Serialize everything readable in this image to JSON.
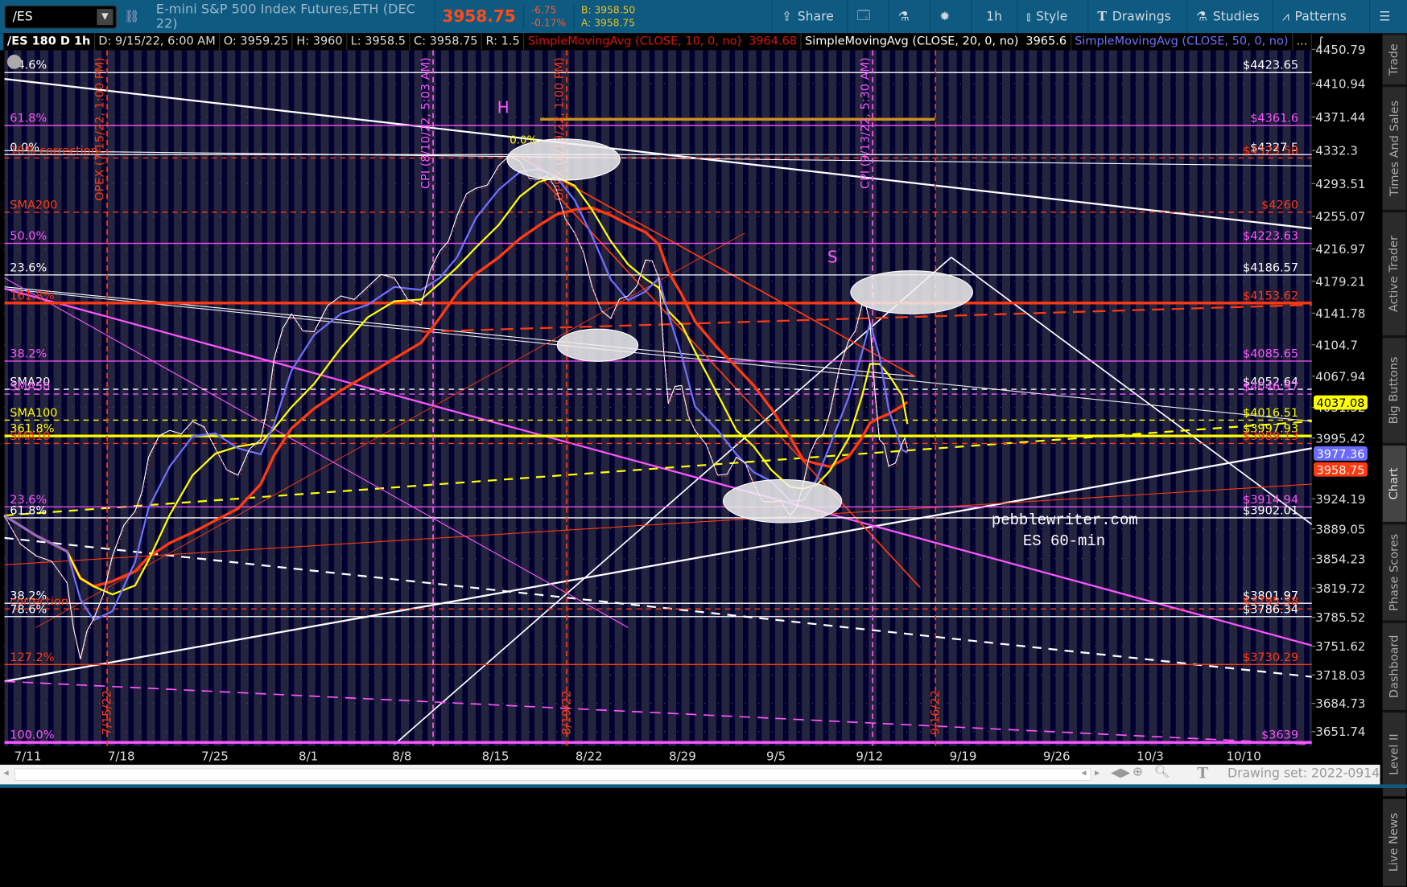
{
  "toolbar": {
    "symbol": "/ES",
    "description": "E-mini S&P 500 Index Futures,ETH (DEC 22)",
    "last": "3958.75",
    "change": "-6.75",
    "change_pct": "-0.17%",
    "bid": "B: 3958.50",
    "ask": "A: 3958.75",
    "buttons": [
      {
        "label": "Share",
        "icon": "share-icon"
      },
      {
        "label": "",
        "icon": "info-card-icon"
      },
      {
        "label": "",
        "icon": "flask-icon"
      },
      {
        "label": "",
        "icon": "gear-icon"
      },
      {
        "label": "1h",
        "icon": ""
      },
      {
        "label": "Style",
        "icon": "candle-icon"
      },
      {
        "label": "Drawings",
        "icon": "text-t-icon"
      },
      {
        "label": "Studies",
        "icon": "flask-icon"
      },
      {
        "label": "Patterns",
        "icon": "patterns-icon"
      },
      {
        "label": "",
        "icon": "menu-icon"
      }
    ]
  },
  "infobar": {
    "title": "/ES 180 D 1h",
    "date": "D: 9/15/22, 6:00 AM",
    "open": "O: 3959.25",
    "high": "H: 3960",
    "low": "L: 3958.5",
    "close": "C: 3958.75",
    "range": "R: 1.5",
    "sma10": "SimpleMovingAvg (CLOSE, 10, 0, no)",
    "sma10_val": "3964.68",
    "sma20": "SimpleMovingAvg (CLOSE, 20, 0, no)",
    "sma20_val": "3965.6",
    "sma50": "SimpleMovingAvg (CLOSE, 50, 0, no)",
    "more": "..."
  },
  "colors": {
    "red": "#ff3a10",
    "magenta": "#ff55ff",
    "white": "#ffffff",
    "yellow": "#ffff00",
    "blue": "#7070ff"
  },
  "price_axis": [
    "4450.79",
    "4410.94",
    "4371.44",
    "4332.3",
    "4293.51",
    "4255.07",
    "4216.97",
    "4179.21",
    "4141.78",
    "4104.7",
    "4067.94",
    "4031.52",
    "3995.42",
    "3924.19",
    "3889.05",
    "3854.23",
    "3819.72",
    "3785.52",
    "3751.62",
    "3718.03",
    "3684.73",
    "3651.74"
  ],
  "date_axis": [
    {
      "label": "7/11",
      "day": 0
    },
    {
      "label": "7/18",
      "day": 7
    },
    {
      "label": "7/25",
      "day": 14
    },
    {
      "label": "8/1",
      "day": 21
    },
    {
      "label": "8/8",
      "day": 28
    },
    {
      "label": "8/15",
      "day": 35
    },
    {
      "label": "8/22",
      "day": 42
    },
    {
      "label": "8/29",
      "day": 49
    },
    {
      "label": "9/5",
      "day": 56
    },
    {
      "label": "9/12",
      "day": 63
    },
    {
      "label": "9/19",
      "day": 70
    },
    {
      "label": "9/26",
      "day": 77
    },
    {
      "label": "10/3",
      "day": 84
    },
    {
      "label": "10/10",
      "day": 91
    }
  ],
  "badges": [
    {
      "value": "4037.08",
      "color": "#ffff00",
      "text": "#000"
    },
    {
      "value": "3977.36",
      "color": "#6a6aff",
      "text": "#fff"
    },
    {
      "value": "3958.75",
      "color": "#ff3a10",
      "text": "#fff"
    }
  ],
  "levels": [
    {
      "price": 4423.65,
      "label": "$4423.65",
      "left": "14.6%",
      "color": "#ffffff",
      "style": "solid"
    },
    {
      "price": 4361.6,
      "label": "$4361.6",
      "left": "61.8%",
      "color": "#ff55ff",
      "style": "solid"
    },
    {
      "price": 4327.5,
      "label": "$4327.5",
      "left": "0.0%",
      "color": "#ffffff",
      "style": "solid"
    },
    {
      "price": 4323.58,
      "label": "$4323.58",
      "left": "10% correction",
      "color": "#ff3a10",
      "style": "dash"
    },
    {
      "price": 4260,
      "label": "$4260",
      "left": "SMA200",
      "color": "#ff3a10",
      "style": "dash"
    },
    {
      "price": 4223.63,
      "label": "$4223.63",
      "left": "50.0%",
      "color": "#ff55ff",
      "style": "solid"
    },
    {
      "price": 4186.57,
      "label": "$4186.57",
      "left": "23.6%",
      "color": "#ffffff",
      "style": "solid"
    },
    {
      "price": 4153.62,
      "label": "$4153.62",
      "left": "161.8%",
      "color": "#ff3a10",
      "style": "thick"
    },
    {
      "price": 4085.65,
      "label": "$4085.65",
      "left": "38.2%",
      "color": "#ff55ff",
      "style": "solid"
    },
    {
      "price": 4052.64,
      "label": "$4052.64",
      "left": "SMA20",
      "color": "#ffffff",
      "style": "dash"
    },
    {
      "price": 4046.97,
      "label": "$4046.97",
      "left": "SMA50",
      "color": "#ff55ff",
      "style": "dash"
    },
    {
      "price": 4016.51,
      "label": "$4016.51",
      "left": "SMA100",
      "color": "#ffff00",
      "style": "dash"
    },
    {
      "price": 3997.93,
      "label": "$3997.93",
      "left": "361.8%",
      "color": "#ffff00",
      "style": "thick"
    },
    {
      "price": 3989.13,
      "label": "$3989.13",
      "left": "SMA10",
      "color": "#ff3a10",
      "style": "dash"
    },
    {
      "price": 3914.94,
      "label": "$3914.94",
      "left": "23.6%",
      "color": "#ff55ff",
      "style": "solid"
    },
    {
      "price": 3902.01,
      "label": "$3902.01",
      "left": "61.8%",
      "color": "#ffffff",
      "style": "solid"
    },
    {
      "price": 3801.97,
      "label": "$3801.97",
      "left": "38.2%",
      "color": "#ffffff",
      "style": "solid"
    },
    {
      "price": 3795.38,
      "label": "$3795.38",
      "left": "correction",
      "color": "#ff3a10",
      "style": "dash"
    },
    {
      "price": 3786.34,
      "label": "$3786.34",
      "left": "78.6%",
      "color": "#ffffff",
      "style": "solid"
    },
    {
      "price": 3730.29,
      "label": "$3730.29",
      "left": "127.2%",
      "color": "#ff3a10",
      "style": "solid"
    },
    {
      "price": 3639,
      "label": "$3639",
      "left": "100.0%",
      "color": "#ff55ff",
      "style": "thick"
    }
  ],
  "events": [
    {
      "day": 6.0,
      "label": "OPEX (7/15/22, 1:00 PM)",
      "date": "7/15/22",
      "color": "#ff3a10"
    },
    {
      "day": 30.4,
      "label": "CPI (8/10/22, 5:03 AM)",
      "date": "",
      "color": "#ff55ff"
    },
    {
      "day": 40.4,
      "label": "OPEX (8/19/22, 1:00 PM)",
      "date": "8/19/22",
      "color": "#ff3a10"
    },
    {
      "day": 63.3,
      "label": "CPI (9/13/22, 5:30 AM)",
      "date": "",
      "color": "#ff55ff"
    },
    {
      "day": 68.0,
      "label": "",
      "date": "9/16/22",
      "color": "#ff3a10"
    }
  ],
  "annotations": {
    "h": "H",
    "s": "S",
    "zero": "0.0%",
    "watermark1": "pebblewriter.com",
    "watermark2": "ES 60-min"
  },
  "chart_data": {
    "type": "line",
    "title": "/ES 180 D 1h",
    "ylim": [
      3630,
      4455
    ],
    "x_unit": "days since 7/11/22",
    "x": [
      -1.7,
      0.7,
      3.0,
      4.0,
      5.0,
      6.4,
      8.1,
      9.1,
      10.7,
      12.4,
      14.1,
      15.8,
      17.5,
      18.5,
      19.8,
      21.5,
      23.5,
      25.5,
      27.5,
      29.5,
      30.9,
      32.2,
      33.6,
      35.3,
      36.9,
      38.3,
      39.6,
      41,
      42.3,
      43.7,
      45,
      46.3,
      47.3,
      48,
      49,
      50,
      51.7,
      53.1,
      54.4,
      55.7,
      57.1,
      58.1,
      59.1,
      60.1,
      61.5,
      62.5,
      63.1,
      63.8,
      64.5,
      65.5,
      65.9
    ],
    "close": [
      3904.8,
      3857.5,
      3826,
      3736.7,
      3784,
      3857.5,
      3910,
      3973,
      4004.5,
      4015,
      3983.5,
      3952,
      3994,
      4088.5,
      4141,
      4120,
      4162,
      4172.5,
      4183,
      4151.5,
      4214.5,
      4256.5,
      4288,
      4314.3,
      4319.5,
      4298.5,
      4288,
      4235.5,
      4172.5,
      4135.8,
      4162,
      4204,
      4183,
      4036,
      4057,
      4004.5,
      3952,
      3973,
      3941.5,
      3920.5,
      3904.8,
      3941.5,
      3994,
      4025.5,
      4109.5,
      4151.5,
      4130.5,
      3994,
      3962.5,
      3988.8,
      3983.5
    ],
    "series": [
      {
        "name": "SMA10",
        "color": "#7070ff",
        "window": 2
      },
      {
        "name": "SMA20",
        "color": "#ffff00",
        "window": 4
      },
      {
        "name": "SMA50",
        "color": "#ff3a10",
        "window": 8
      }
    ]
  },
  "sidebar": [
    "Trade",
    "Times And Sales",
    "Active Trader",
    "Big Buttons",
    "Chart",
    "Phase Scores",
    "Dashboard",
    "Level II",
    "Live News"
  ],
  "footer": {
    "drawing_set": "Drawing set: 2022-0914"
  }
}
